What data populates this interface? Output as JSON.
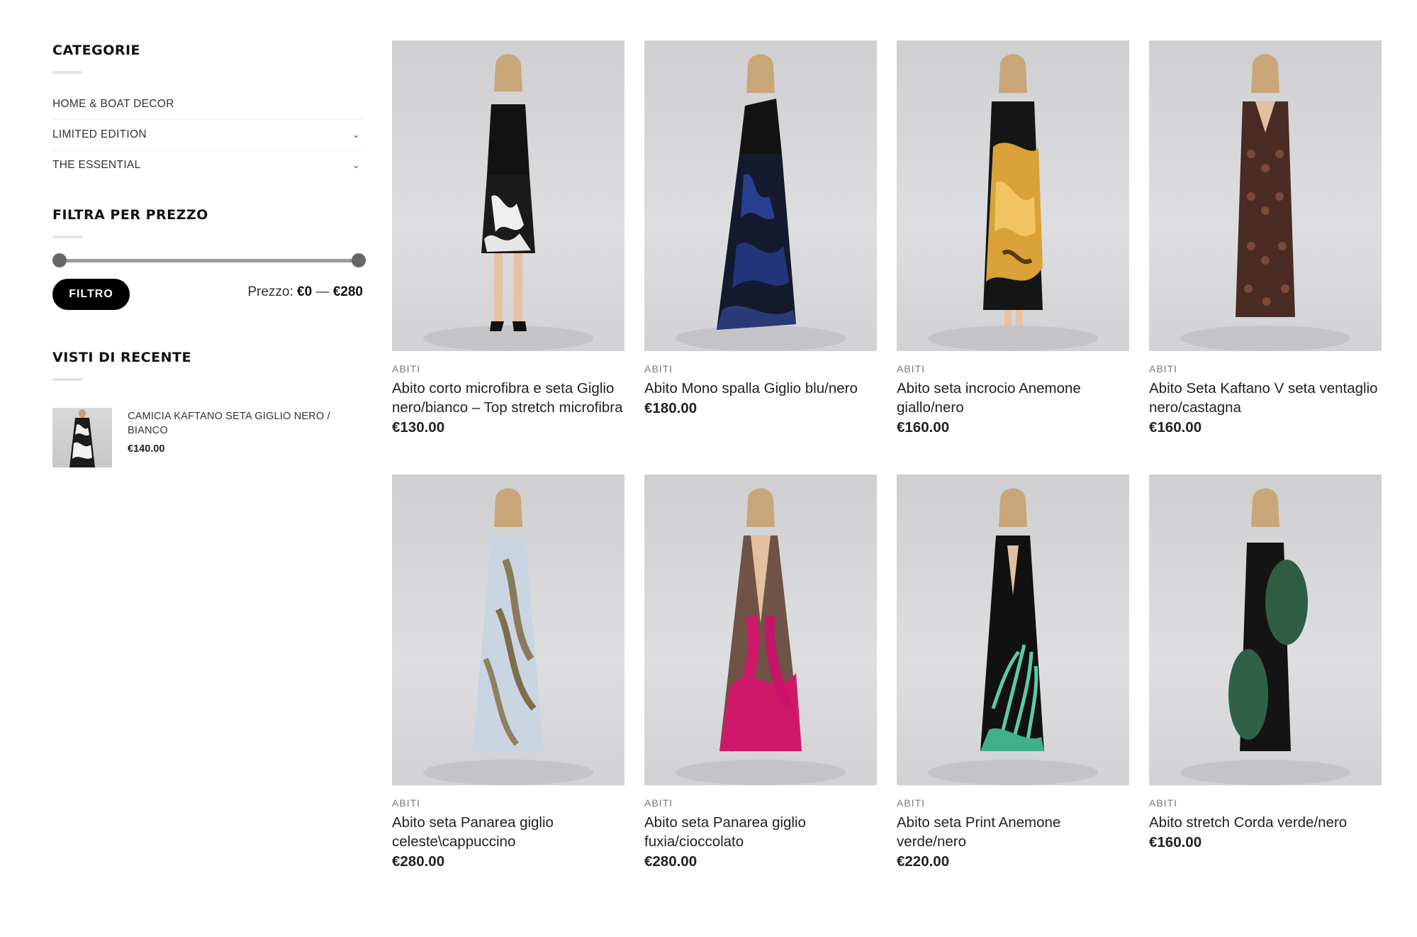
{
  "sidebar": {
    "categories": {
      "title": "CATEGORIE",
      "items": [
        {
          "label": "HOME & BOAT DECOR",
          "has_children": false
        },
        {
          "label": "LIMITED EDITION",
          "has_children": true
        },
        {
          "label": "THE ESSENTIAL",
          "has_children": true
        }
      ]
    },
    "price_filter": {
      "title": "FILTRA PER PREZZO",
      "button_label": "FILTRO",
      "price_prefix": "Prezzo:",
      "min": "€0",
      "separator": "—",
      "max": "€280"
    },
    "recent": {
      "title": "VISTI DI RECENTE",
      "items": [
        {
          "name": "CAMICIA KAFTANO SETA GIGLIO NERO / BIANCO",
          "price": "€140.00"
        }
      ]
    }
  },
  "products": [
    {
      "category": "ABITI",
      "name": "Abito corto microfibra e seta Giglio nero/bianco – Top stretch microfibra",
      "price": "€130.00"
    },
    {
      "category": "ABITI",
      "name": "Abito Mono spalla Giglio blu/nero",
      "price": "€180.00"
    },
    {
      "category": "ABITI",
      "name": "Abito seta incrocio Anemone giallo/nero",
      "price": "€160.00"
    },
    {
      "category": "ABITI",
      "name": "Abito Seta Kaftano V seta ventaglio nero/castagna",
      "price": "€160.00"
    },
    {
      "category": "ABITI",
      "name": "Abito seta Panarea giglio celeste\\cappuccino",
      "price": "€280.00"
    },
    {
      "category": "ABITI",
      "name": "Abito seta Panarea giglio fuxia/cioccolato",
      "price": "€280.00"
    },
    {
      "category": "ABITI",
      "name": "Abito seta Print Anemone verde/nero",
      "price": "€220.00"
    },
    {
      "category": "ABITI",
      "name": "Abito stretch Corda verde/nero",
      "price": "€160.00"
    }
  ],
  "colors": {
    "button_bg": "#000000",
    "text": "#222222",
    "muted": "#777777",
    "slider": "#9a9a9a"
  }
}
